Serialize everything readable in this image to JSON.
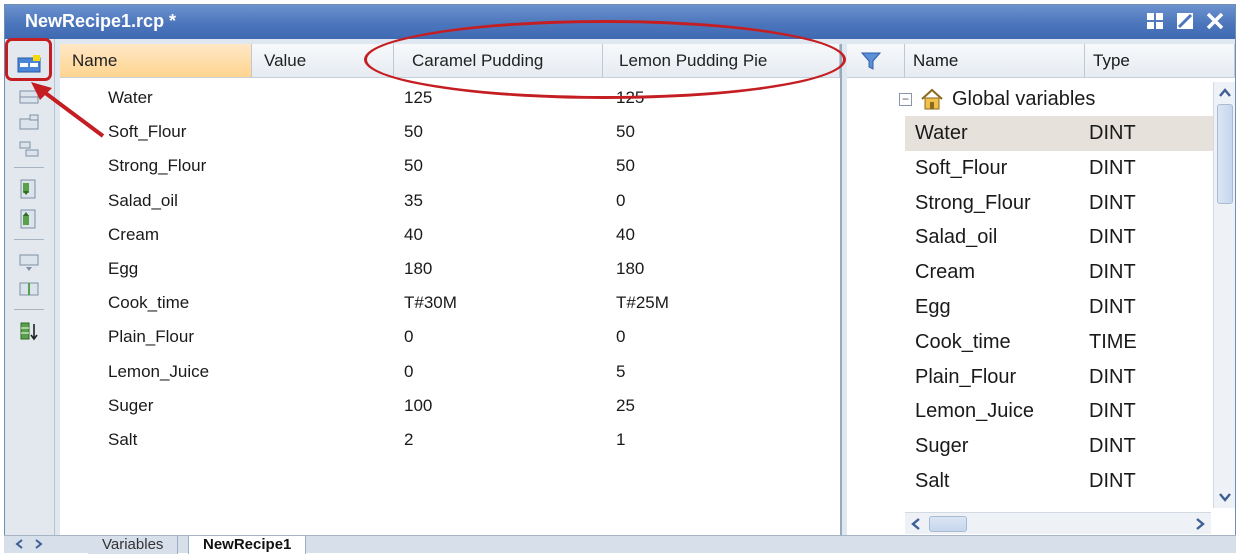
{
  "window": {
    "title": "NewRecipe1.rcp *"
  },
  "title_controls": [
    "tile-icon",
    "maximize-icon",
    "close-icon"
  ],
  "recipe_grid": {
    "columns": [
      "Name",
      "Value",
      "Caramel  Pudding",
      "Lemon Pudding Pie"
    ],
    "rows": [
      [
        "Water",
        "",
        "125",
        "125"
      ],
      [
        "Soft_Flour",
        "",
        "50",
        "50"
      ],
      [
        "Strong_Flour",
        "",
        "50",
        "50"
      ],
      [
        "Salad_oil",
        "",
        "35",
        "0"
      ],
      [
        "Cream",
        "",
        "40",
        "40"
      ],
      [
        "Egg",
        "",
        "180",
        "180"
      ],
      [
        "Cook_time",
        "",
        "T#30M",
        "T#25M"
      ],
      [
        "Plain_Flour",
        "",
        "0",
        "0"
      ],
      [
        "Lemon_Juice",
        "",
        "0",
        "5"
      ],
      [
        "Suger",
        "",
        "100",
        "25"
      ],
      [
        "Salt",
        "",
        "2",
        "1"
      ]
    ]
  },
  "variables_panel": {
    "columns": [
      "Name",
      "Type"
    ],
    "group_label": "Global variables",
    "rows": [
      [
        "Water",
        "DINT"
      ],
      [
        "Soft_Flour",
        "DINT"
      ],
      [
        "Strong_Flour",
        "DINT"
      ],
      [
        "Salad_oil",
        "DINT"
      ],
      [
        "Cream",
        "DINT"
      ],
      [
        "Egg",
        "DINT"
      ],
      [
        "Cook_time",
        "TIME"
      ],
      [
        "Plain_Flour",
        "DINT"
      ],
      [
        "Lemon_Juice",
        "DINT"
      ],
      [
        "Suger",
        "DINT"
      ],
      [
        "Salt",
        "DINT"
      ]
    ]
  },
  "tabs": [
    "Variables",
    "NewRecipe1"
  ],
  "colors": {
    "titlebar": "#4c76bc",
    "highlight": "#c41e23",
    "header_selected": "#ffd48f",
    "row_selected": "#e6e1da"
  }
}
